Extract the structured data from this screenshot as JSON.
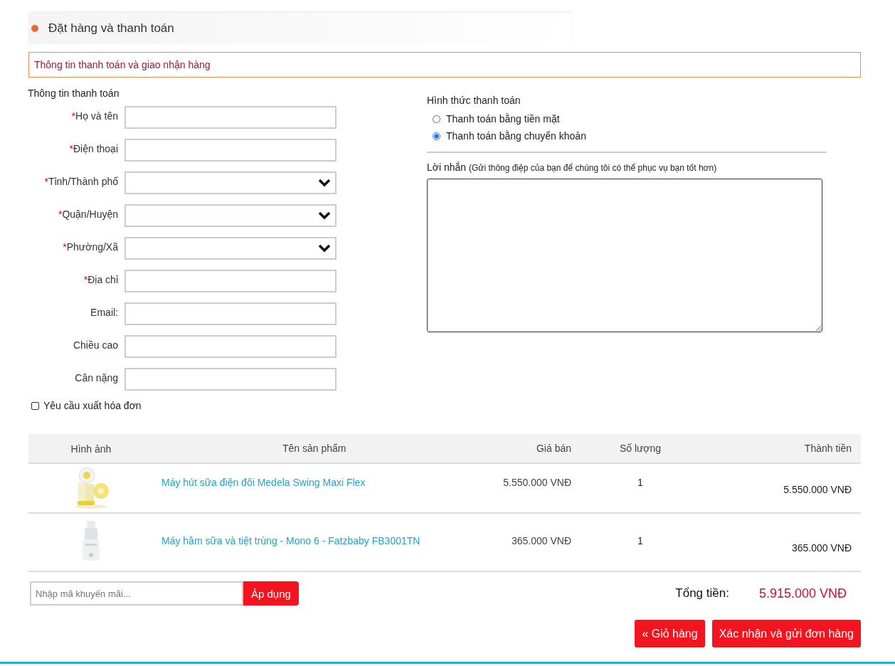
{
  "header": {
    "title": "Đặt hàng và thanh toán"
  },
  "notice": "Thông tin thanh toán và giao nhận hàng",
  "billing": {
    "heading": "Thông tin thanh toán",
    "fields": [
      {
        "label": "Họ và tên",
        "required_mark": "*",
        "kind": "text"
      },
      {
        "label": "Điện thoại",
        "required_mark": "*",
        "kind": "text"
      },
      {
        "label": "Tỉnh/Thành phố",
        "required_mark": "*",
        "kind": "select"
      },
      {
        "label": "Quận/Huyện",
        "required_mark": "*",
        "kind": "select"
      },
      {
        "label": "Phường/Xã",
        "required_mark": "*",
        "kind": "select"
      },
      {
        "label": "Địa chỉ",
        "required_mark": "*",
        "kind": "text"
      },
      {
        "label": "Email:",
        "kind": "text"
      },
      {
        "label": "Chiều cao",
        "kind": "text"
      },
      {
        "label": "Cân nặng",
        "kind": "text"
      }
    ],
    "invoice_request": {
      "label": "Yêu cầu xuất hóa đơn",
      "checked": false
    }
  },
  "payment": {
    "heading": "Hình thức thanh toán",
    "options": [
      {
        "label": "Thanh toán bằng tiền mặt",
        "selected": false
      },
      {
        "label": "Thanh toán bằng chuyển khoản",
        "selected": true
      }
    ]
  },
  "message": {
    "label": "Lời nhắn",
    "hint": "(Gửi thông điệp của bạn để chúng tôi có thể phục vụ bạn tốt hơn)"
  },
  "cart": {
    "columns": [
      "Hình ảnh",
      "Tên sản phẩm",
      "Giá bán",
      "Số lượng",
      "Thành tiền"
    ],
    "rows": [
      {
        "name": "Máy hút sữa điện đôi Medela Swing Maxi Flex",
        "price": "5.550.000 VNĐ",
        "quantity": "1",
        "total": "5.550.000 VNĐ"
      },
      {
        "name": "Máy hâm sữa và tiệt trùng - Mono 6 - Fatzbaby FB3001TN",
        "price": "365.000 VNĐ",
        "quantity": "1",
        "total": "365.000 VNĐ"
      }
    ]
  },
  "promo": {
    "placeholder": "Nhập mã khuyến mãi...",
    "button": "Áp dụng"
  },
  "summary": {
    "label": "Tổng tiền:",
    "value": "5.915.000 VNĐ"
  },
  "actions": [
    {
      "label": "« Giỏ hàng"
    },
    {
      "label": "Xác nhận và gửi đơn hàng"
    }
  ]
}
